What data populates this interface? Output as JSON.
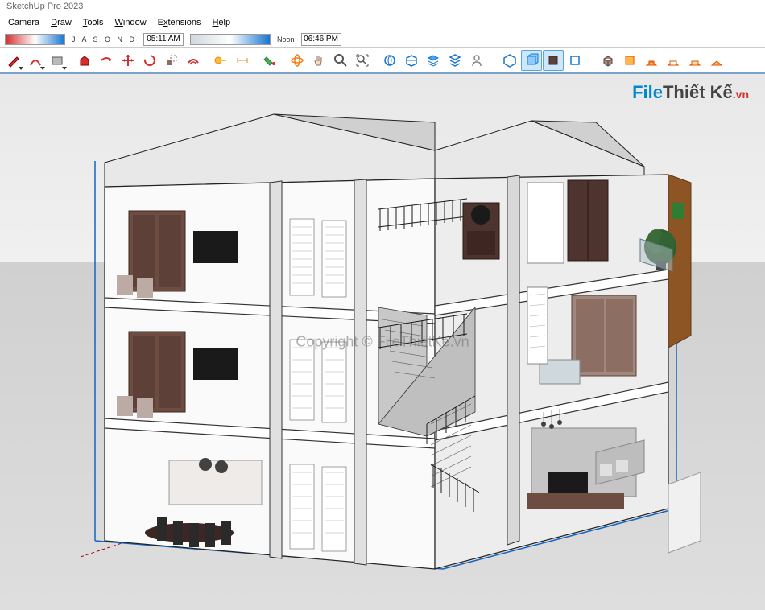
{
  "title": "SketchUp Pro 2023",
  "menu": {
    "camera": "Camera",
    "draw": "Draw",
    "tools": "Tools",
    "window": "Window",
    "extensions": "Extensions",
    "help": "Help"
  },
  "shadow": {
    "months": "J A S O N D",
    "time_start": "05:11 AM",
    "noon": "Noon",
    "time_end": "06:46 PM"
  },
  "watermark": {
    "logo_file": "File",
    "logo_thiet": "Thiết Kế",
    "logo_vn": ".vn",
    "copyright": "Copyright © FileThietKe.vn"
  },
  "tools": {
    "pencil": "pencil",
    "arc": "arc",
    "rectangle": "rectangle",
    "push": "push-pull",
    "move": "move",
    "rotate": "rotate",
    "scale": "scale",
    "offset": "offset",
    "tape": "tape-measure",
    "text": "text",
    "paint": "paint-bucket",
    "eraser": "eraser",
    "orbit": "orbit",
    "pan": "pan",
    "zoom": "zoom",
    "zoom_extents": "zoom-extents"
  }
}
